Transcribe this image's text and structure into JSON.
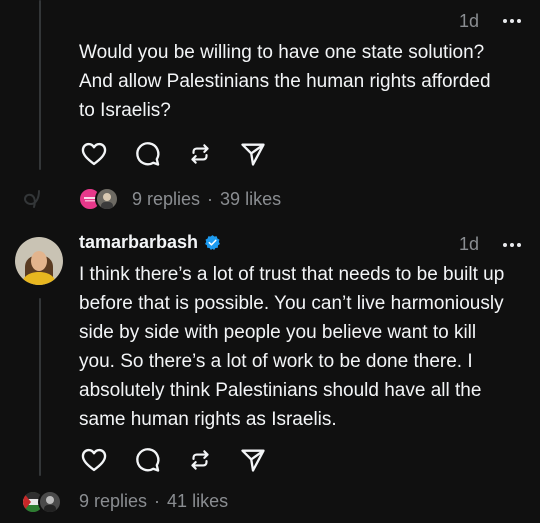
{
  "colors": {
    "background": "#101010",
    "text": "#f3f5f7",
    "muted": "#8a8d91",
    "thread_line": "#333638",
    "verified": "#1d9bf0"
  },
  "post1": {
    "time": "1d",
    "text": "Would you be willing to have one state solution?\nAnd allow Palestinians the human rights afforded\nto Israelis?",
    "stats": {
      "replies": "9 replies",
      "separator": "·",
      "likes": "39 likes"
    }
  },
  "post2": {
    "username": "tamarbarbash",
    "verified": true,
    "time": "1d",
    "text": "I think there’s a lot of trust that needs to be built up\nbefore that is possible. You can’t live harmoniously\nside by side with people you believe want to kill\nyou. So there’s a lot of work to be done there. I\nabsolutely think Palestinians should have all the\nsame human rights as Israelis.",
    "stats": {
      "replies": "9 replies",
      "separator": "·",
      "likes": "41 likes"
    }
  },
  "icons": {
    "like": "heart-icon",
    "reply": "comment-icon",
    "repost": "repost-icon",
    "share": "send-icon",
    "more": "more-horizontal-icon",
    "verified": "verified-badge-icon"
  }
}
